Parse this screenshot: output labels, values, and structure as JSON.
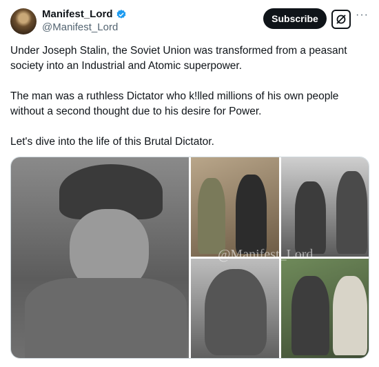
{
  "user": {
    "display_name": "Manifest_Lord",
    "handle": "@Manifest_Lord",
    "verified": true,
    "avatar_icon": "avatar"
  },
  "actions": {
    "subscribe_label": "Subscribe",
    "grok_icon": "grok-icon",
    "more_label": "···"
  },
  "tweet": {
    "paragraphs": [
      "Under Joseph Stalin, the Soviet Union was transformed from a peasant society into an Industrial and Atomic superpower.",
      "The man was a ruthless Dictator who k!lled millions of his own people without a second thought due to his desire for Power.",
      "Let's dive into the life of this Brutal Dictator."
    ]
  },
  "media": {
    "watermark": "@Manifest_Lord",
    "photo_count": 5
  },
  "colors": {
    "accent": "#1d9bf0",
    "text": "#0f1419",
    "muted": "#536471"
  }
}
